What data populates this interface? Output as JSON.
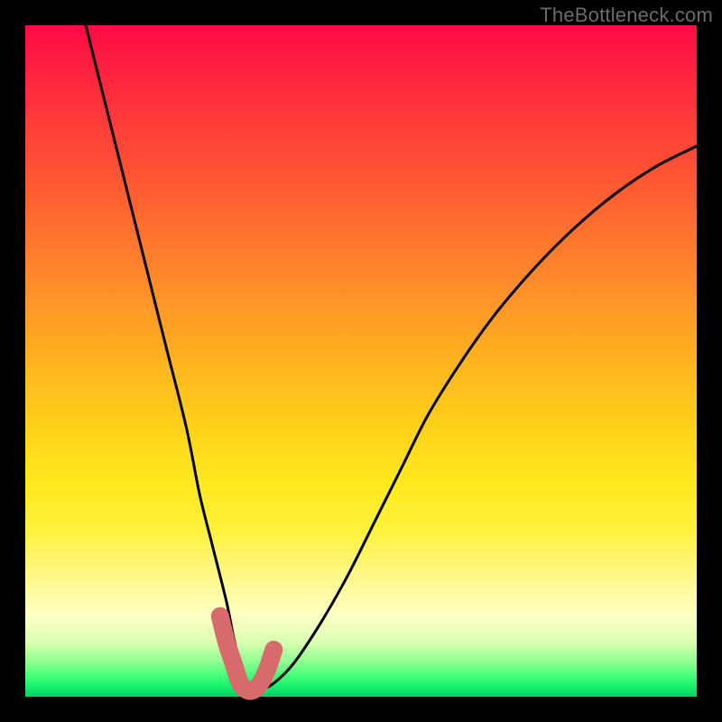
{
  "watermark": "TheBottleneck.com",
  "chart_data": {
    "type": "line",
    "title": "",
    "xlabel": "",
    "ylabel": "",
    "xlim": [
      0,
      100
    ],
    "ylim": [
      0,
      100
    ],
    "grid": false,
    "legend": false,
    "series": [
      {
        "name": "bottleneck-curve",
        "color": "#000000",
        "x": [
          9,
          12,
          15,
          18,
          21,
          24,
          26,
          28,
          30,
          31,
          32,
          33,
          34,
          35,
          37,
          40,
          44,
          48,
          52,
          56,
          60,
          65,
          70,
          76,
          82,
          88,
          94,
          100
        ],
        "y": [
          100,
          88,
          76,
          64,
          52,
          40,
          30,
          22,
          14,
          9,
          5,
          2,
          1,
          1,
          2,
          5,
          11,
          18,
          26,
          34,
          42,
          50,
          57,
          64,
          70,
          75,
          79,
          82
        ]
      },
      {
        "name": "optimal-highlight",
        "color": "#d86a6d",
        "x": [
          29,
          30,
          31,
          32,
          33,
          34,
          35,
          36,
          37
        ],
        "y": [
          12,
          8,
          5,
          2,
          1,
          1,
          2,
          4,
          7
        ]
      }
    ],
    "annotations": []
  },
  "colors": {
    "frame": "#000000",
    "curve": "#000000",
    "highlight": "#d86a6d"
  }
}
